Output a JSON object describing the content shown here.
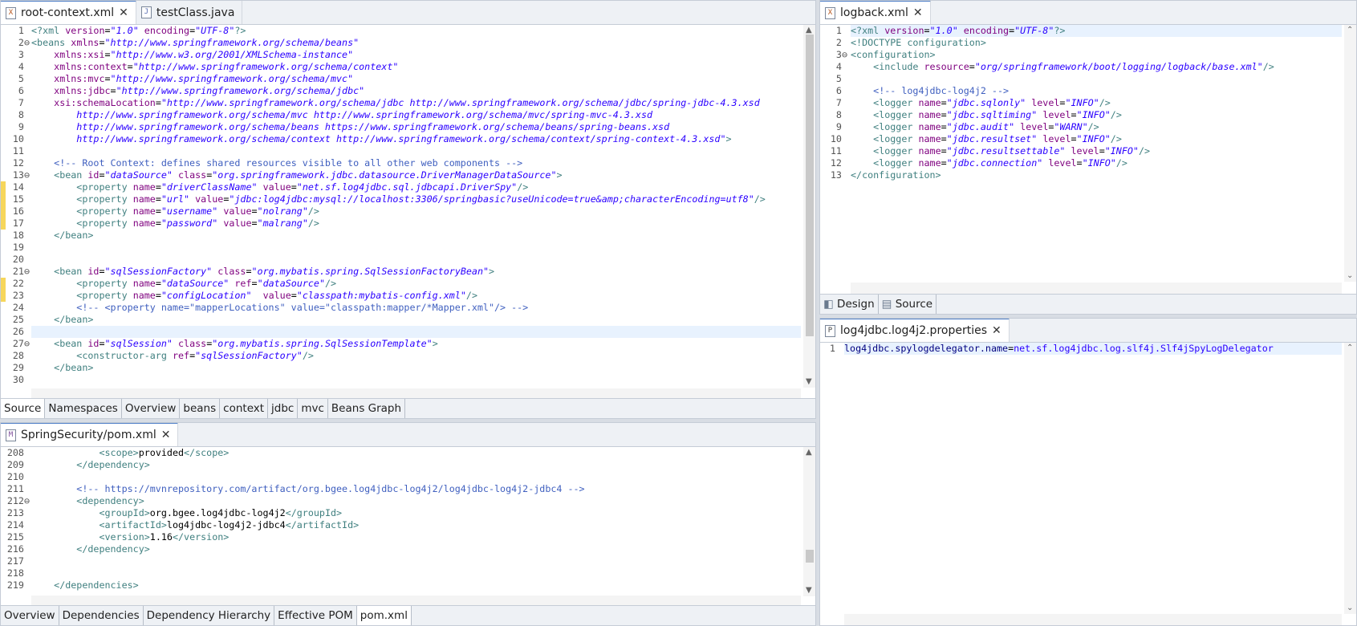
{
  "tabs_top_left": [
    {
      "label": "root-context.xml",
      "icon": "xml-file-icon",
      "closable": true,
      "active": true
    },
    {
      "label": "testClass.java",
      "icon": "java-file-icon",
      "closable": false,
      "active": false
    }
  ],
  "root_context_lines": [
    {
      "n": "1",
      "fold": false,
      "html": "<span style='color:#3f7f7f'>&lt;?xml</span> <span style='color:#7f007f'>version</span>=<span style='color:#2a00ff;font-style:italic'>\"1.0\"</span> <span style='color:#7f007f'>encoding</span>=<span style='color:#2a00ff;font-style:italic'>\"UTF-8\"</span><span style='color:#3f7f7f'>?&gt;</span>"
    },
    {
      "n": "2",
      "fold": true,
      "html": "<span style='color:#3f7f7f'>&lt;beans</span> <span style='color:#7f007f'>xmlns</span>=<span style='color:#2a00ff;font-style:italic'>\"http://www.springframework.org/schema/beans\"</span>"
    },
    {
      "n": "3",
      "html": "    <span style='color:#7f007f'>xmlns:xsi</span>=<span style='color:#2a00ff;font-style:italic'>\"http://www.w3.org/2001/XMLSchema-instance\"</span>"
    },
    {
      "n": "4",
      "html": "    <span style='color:#7f007f'>xmlns:context</span>=<span style='color:#2a00ff;font-style:italic'>\"http://www.springframework.org/schema/context\"</span>"
    },
    {
      "n": "5",
      "html": "    <span style='color:#7f007f'>xmlns:mvc</span>=<span style='color:#2a00ff;font-style:italic'>\"http://www.springframework.org/schema/mvc\"</span>"
    },
    {
      "n": "6",
      "html": "    <span style='color:#7f007f'>xmlns:jdbc</span>=<span style='color:#2a00ff;font-style:italic'>\"http://www.springframework.org/schema/jdbc\"</span>"
    },
    {
      "n": "7",
      "html": "    <span style='color:#7f007f'>xsi:schemaLocation</span>=<span style='color:#2a00ff;font-style:italic'>\"http://www.springframework.org/schema/jdbc http://www.springframework.org/schema/jdbc/spring-jdbc-4.3.xsd</span>"
    },
    {
      "n": "8",
      "html": "<span style='color:#2a00ff;font-style:italic'>        http://www.springframework.org/schema/mvc http://www.springframework.org/schema/mvc/spring-mvc-4.3.xsd</span>"
    },
    {
      "n": "9",
      "html": "<span style='color:#2a00ff;font-style:italic'>        http://www.springframework.org/schema/beans https://www.springframework.org/schema/beans/spring-beans.xsd</span>"
    },
    {
      "n": "10",
      "html": "<span style='color:#2a00ff;font-style:italic'>        http://www.springframework.org/schema/context http://www.springframework.org/schema/context/spring-context-4.3.xsd\"</span><span style='color:#3f7f7f'>&gt;</span>"
    },
    {
      "n": "11",
      "html": ""
    },
    {
      "n": "12",
      "html": "    <span style='color:#3f5fbf'>&lt;!-- Root Context: defines shared resources visible to all other web components --&gt;</span>"
    },
    {
      "n": "13",
      "fold": true,
      "html": "    <span style='color:#3f7f7f'>&lt;bean</span> <span style='color:#7f007f'>id</span>=<span style='color:#2a00ff;font-style:italic'>\"dataSource\"</span> <span style='color:#7f007f'>class</span>=<span style='color:#2a00ff;font-style:italic'>\"org.springframework.jdbc.datasource.DriverManagerDataSource\"</span><span style='color:#3f7f7f'>&gt;</span>"
    },
    {
      "n": "14",
      "warn": true,
      "html": "        <span style='color:#3f7f7f'>&lt;property</span> <span style='color:#7f007f'>name</span>=<span style='color:#2a00ff;font-style:italic'>\"driverClassName\"</span> <span style='color:#7f007f'>value</span>=<span style='color:#2a00ff;font-style:italic'>\"net.sf.log4jdbc.sql.jdbcapi.DriverSpy\"</span><span style='color:#3f7f7f'>/&gt;</span>"
    },
    {
      "n": "15",
      "warn": true,
      "html": "        <span style='color:#3f7f7f'>&lt;property</span> <span style='color:#7f007f'>name</span>=<span style='color:#2a00ff;font-style:italic'>\"url\"</span> <span style='color:#7f007f'>value</span>=<span style='color:#2a00ff;font-style:italic'>\"jdbc:log4jdbc:mysql://localhost:3306/springbasic?useUnicode=true&amp;amp;characterEncoding=utf8\"</span><span style='color:#3f7f7f'>/&gt;</span>"
    },
    {
      "n": "16",
      "warn": true,
      "html": "        <span style='color:#3f7f7f'>&lt;property</span> <span style='color:#7f007f'>name</span>=<span style='color:#2a00ff;font-style:italic'>\"username\"</span> <span style='color:#7f007f'>value</span>=<span style='color:#2a00ff;font-style:italic'>\"nolrang\"</span><span style='color:#3f7f7f'>/&gt;</span>"
    },
    {
      "n": "17",
      "warn": true,
      "html": "        <span style='color:#3f7f7f'>&lt;property</span> <span style='color:#7f007f'>name</span>=<span style='color:#2a00ff;font-style:italic'>\"password\"</span> <span style='color:#7f007f'>value</span>=<span style='color:#2a00ff;font-style:italic'>\"malrang\"</span><span style='color:#3f7f7f'>/&gt;</span>"
    },
    {
      "n": "18",
      "html": "    <span style='color:#3f7f7f'>&lt;/bean&gt;</span>"
    },
    {
      "n": "19",
      "html": ""
    },
    {
      "n": "20",
      "html": ""
    },
    {
      "n": "21",
      "fold": true,
      "html": "    <span style='color:#3f7f7f'>&lt;bean</span> <span style='color:#7f007f'>id</span>=<span style='color:#2a00ff;font-style:italic'>\"sqlSessionFactory\"</span> <span style='color:#7f007f'>class</span>=<span style='color:#2a00ff;font-style:italic'>\"org.mybatis.spring.SqlSessionFactoryBean\"</span><span style='color:#3f7f7f'>&gt;</span>"
    },
    {
      "n": "22",
      "warn": true,
      "html": "        <span style='color:#3f7f7f'>&lt;property</span> <span style='color:#7f007f'>name</span>=<span style='color:#2a00ff;font-style:italic'>\"dataSource\"</span> <span style='color:#7f007f'>ref</span>=<span style='color:#2a00ff;font-style:italic'>\"dataSource\"</span><span style='color:#3f7f7f'>/&gt;</span>"
    },
    {
      "n": "23",
      "warn": true,
      "html": "        <span style='color:#3f7f7f'>&lt;property</span> <span style='color:#7f007f'>name</span>=<span style='color:#2a00ff;font-style:italic'>\"configLocation\"</span>  <span style='color:#7f007f'>value</span>=<span style='color:#2a00ff;font-style:italic'>\"classpath:mybatis-config.xml\"</span><span style='color:#3f7f7f'>/&gt;</span>"
    },
    {
      "n": "24",
      "html": "        <span style='color:#3f5fbf'>&lt;!-- &lt;property name=\"mapperLocations\" value=\"classpath:mapper/*Mapper.xml\"/&gt; --&gt;</span>"
    },
    {
      "n": "25",
      "html": "    <span style='color:#3f7f7f'>&lt;/bean&gt;</span>"
    },
    {
      "n": "26",
      "hl": true,
      "html": ""
    },
    {
      "n": "27",
      "fold": true,
      "html": "    <span style='color:#3f7f7f'>&lt;bean</span> <span style='color:#7f007f'>id</span>=<span style='color:#2a00ff;font-style:italic'>\"sqlSession\"</span> <span style='color:#7f007f'>class</span>=<span style='color:#2a00ff;font-style:italic'>\"org.mybatis.spring.SqlSessionTemplate\"</span><span style='color:#3f7f7f'>&gt;</span>"
    },
    {
      "n": "28",
      "html": "        <span style='color:#3f7f7f'>&lt;constructor-arg</span> <span style='color:#7f007f'>ref</span>=<span style='color:#2a00ff;font-style:italic'>\"sqlSessionFactory\"</span><span style='color:#3f7f7f'>/&gt;</span>"
    },
    {
      "n": "29",
      "html": "    <span style='color:#3f7f7f'>&lt;/bean&gt;</span>"
    },
    {
      "n": "30",
      "html": ""
    }
  ],
  "root_context_bottom_tabs": [
    "Source",
    "Namespaces",
    "Overview",
    "beans",
    "context",
    "jdbc",
    "mvc",
    "Beans Graph"
  ],
  "tabs_bottom_left": [
    {
      "label": "SpringSecurity/pom.xml",
      "icon": "maven-pom-icon",
      "closable": true,
      "active": true
    }
  ],
  "pom_lines": [
    {
      "n": "208",
      "html": "            <span style='color:#3f7f7f'>&lt;scope&gt;</span>provided<span style='color:#3f7f7f'>&lt;/scope&gt;</span>"
    },
    {
      "n": "209",
      "html": "        <span style='color:#3f7f7f'>&lt;/dependency&gt;</span>"
    },
    {
      "n": "210",
      "html": ""
    },
    {
      "n": "211",
      "html": "        <span style='color:#3f5fbf'>&lt;!-- https://mvnrepository.com/artifact/org.bgee.log4jdbc-log4j2/log4jdbc-log4j2-jdbc4 --&gt;</span>"
    },
    {
      "n": "212",
      "fold": true,
      "html": "        <span style='color:#3f7f7f'>&lt;dependency&gt;</span>"
    },
    {
      "n": "213",
      "html": "            <span style='color:#3f7f7f'>&lt;groupId&gt;</span>org.bgee.log4jdbc-log4j2<span style='color:#3f7f7f'>&lt;/groupId&gt;</span>"
    },
    {
      "n": "214",
      "html": "            <span style='color:#3f7f7f'>&lt;artifactId&gt;</span>log4jdbc-log4j2-jdbc4<span style='color:#3f7f7f'>&lt;/artifactId&gt;</span>"
    },
    {
      "n": "215",
      "html": "            <span style='color:#3f7f7f'>&lt;version&gt;</span>1.16<span style='color:#3f7f7f'>&lt;/version&gt;</span>"
    },
    {
      "n": "216",
      "html": "        <span style='color:#3f7f7f'>&lt;/dependency&gt;</span>"
    },
    {
      "n": "217",
      "html": ""
    },
    {
      "n": "218",
      "html": ""
    },
    {
      "n": "219",
      "html": "    <span style='color:#3f7f7f'>&lt;/dependencies&gt;</span>"
    }
  ],
  "pom_bottom_tabs": [
    "Overview",
    "Dependencies",
    "Dependency Hierarchy",
    "Effective POM",
    "pom.xml"
  ],
  "tabs_top_right": [
    {
      "label": "logback.xml",
      "icon": "xml-file-icon",
      "closable": true,
      "active": true
    }
  ],
  "logback_lines": [
    {
      "n": "1",
      "hl": true,
      "html": "<span style='color:#3f7f7f'>&lt;?xml</span> <span style='color:#7f007f'>version</span>=<span style='color:#2a00ff;font-style:italic'>\"1.0\"</span> <span style='color:#7f007f'>encoding</span>=<span style='color:#2a00ff;font-style:italic'>\"UTF-8\"</span><span style='color:#3f7f7f'>?&gt;</span>"
    },
    {
      "n": "2",
      "html": "<span style='color:#3f7f7f'>&lt;!DOCTYPE configuration&gt;</span>"
    },
    {
      "n": "3",
      "fold": true,
      "html": "<span style='color:#3f7f7f'>&lt;configuration&gt;</span>"
    },
    {
      "n": "4",
      "html": "    <span style='color:#3f7f7f'>&lt;include</span> <span style='color:#7f007f'>resource</span>=<span style='color:#2a00ff;font-style:italic'>\"org/springframework/boot/logging/logback/base.xml\"</span><span style='color:#3f7f7f'>/&gt;</span>"
    },
    {
      "n": "5",
      "html": ""
    },
    {
      "n": "6",
      "html": "    <span style='color:#3f5fbf'>&lt;!-- log4jdbc-log4j2 --&gt;</span>"
    },
    {
      "n": "7",
      "html": "    <span style='color:#3f7f7f'>&lt;logger</span> <span style='color:#7f007f'>name</span>=<span style='color:#2a00ff;font-style:italic'>\"jdbc.sqlonly\"</span> <span style='color:#7f007f'>level</span>=<span style='color:#2a00ff;font-style:italic'>\"INFO\"</span><span style='color:#3f7f7f'>/&gt;</span>"
    },
    {
      "n": "8",
      "html": "    <span style='color:#3f7f7f'>&lt;logger</span> <span style='color:#7f007f'>name</span>=<span style='color:#2a00ff;font-style:italic'>\"jdbc.sqltiming\"</span> <span style='color:#7f007f'>level</span>=<span style='color:#2a00ff;font-style:italic'>\"INFO\"</span><span style='color:#3f7f7f'>/&gt;</span>"
    },
    {
      "n": "9",
      "html": "    <span style='color:#3f7f7f'>&lt;logger</span> <span style='color:#7f007f'>name</span>=<span style='color:#2a00ff;font-style:italic'>\"jdbc.audit\"</span> <span style='color:#7f007f'>level</span>=<span style='color:#2a00ff;font-style:italic'>\"WARN\"</span><span style='color:#3f7f7f'>/&gt;</span>"
    },
    {
      "n": "10",
      "html": "    <span style='color:#3f7f7f'>&lt;logger</span> <span style='color:#7f007f'>name</span>=<span style='color:#2a00ff;font-style:italic'>\"jdbc.resultset\"</span> <span style='color:#7f007f'>level</span>=<span style='color:#2a00ff;font-style:italic'>\"INFO\"</span><span style='color:#3f7f7f'>/&gt;</span>"
    },
    {
      "n": "11",
      "html": "    <span style='color:#3f7f7f'>&lt;logger</span> <span style='color:#7f007f'>name</span>=<span style='color:#2a00ff;font-style:italic'>\"jdbc.resultsettable\"</span> <span style='color:#7f007f'>level</span>=<span style='color:#2a00ff;font-style:italic'>\"INFO\"</span><span style='color:#3f7f7f'>/&gt;</span>"
    },
    {
      "n": "12",
      "html": "    <span style='color:#3f7f7f'>&lt;logger</span> <span style='color:#7f007f'>name</span>=<span style='color:#2a00ff;font-style:italic'>\"jdbc.connection\"</span> <span style='color:#7f007f'>level</span>=<span style='color:#2a00ff;font-style:italic'>\"INFO\"</span><span style='color:#3f7f7f'>/&gt;</span>"
    },
    {
      "n": "13",
      "html": "<span style='color:#3f7f7f'>&lt;/configuration&gt;</span>"
    }
  ],
  "logback_bottom_tabs": [
    {
      "label": "Design",
      "icon": "design-icon"
    },
    {
      "label": "Source",
      "icon": "source-icon"
    }
  ],
  "tabs_bottom_right": [
    {
      "label": "log4jdbc.log4j2.properties",
      "icon": "properties-file-icon",
      "closable": true,
      "active": true
    }
  ],
  "properties_lines": [
    {
      "n": "1",
      "hl": true,
      "html": "<span style='color:#000080'>log4jdbc.spylogdelegator.name</span>=<span style='color:#2a00ff'>net.sf.log4jdbc.log.slf4j.Slf4jSpyLogDelegator</span>"
    }
  ]
}
